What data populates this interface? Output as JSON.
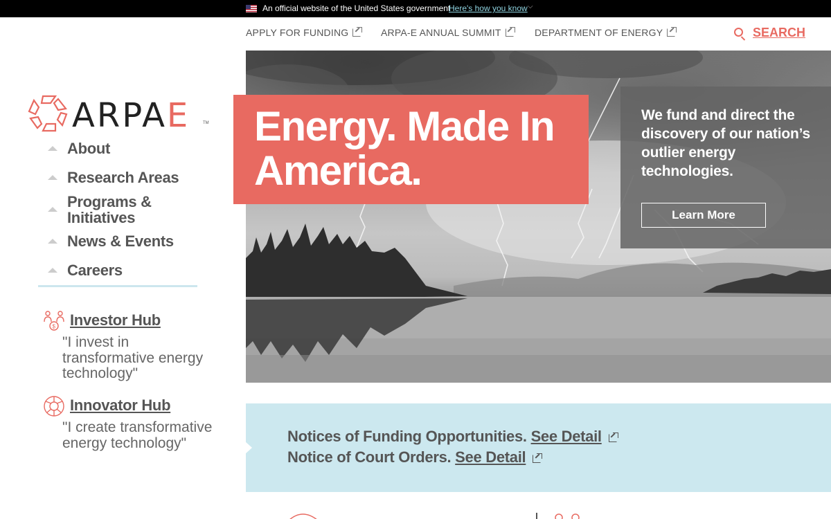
{
  "gov_banner": {
    "text": "An official website of the United States government",
    "link": "Here's how you know"
  },
  "top_nav": {
    "links": [
      {
        "label": "APPLY FOR FUNDING"
      },
      {
        "label": "ARPA-E ANNUAL SUMMIT"
      },
      {
        "label": "DEPARTMENT OF ENERGY"
      }
    ],
    "search_label": "SEARCH"
  },
  "logo": {
    "text_main": "ARPA",
    "text_accent": "E",
    "tm": "TM"
  },
  "side_nav": {
    "items": [
      {
        "label": "About"
      },
      {
        "label": "Research Areas"
      },
      {
        "label": "Programs & Initiatives"
      },
      {
        "label": "News & Events"
      },
      {
        "label": "Careers"
      }
    ]
  },
  "hubs": [
    {
      "title": "Investor Hub",
      "quote": "\"I invest in transformative energy technology\""
    },
    {
      "title": "Innovator Hub",
      "quote": "\"I create transformative energy technology\""
    }
  ],
  "hero": {
    "headline": "Energy. Made In America.",
    "info_text": "We fund and direct the discovery of our nation’s outlier energy technologies.",
    "learn_more": "Learn More"
  },
  "notices": [
    {
      "text": "Notices of Funding Opportunities.",
      "link": "See Detail"
    },
    {
      "text": "Notice of Court Orders.",
      "link": "See Detail"
    }
  ],
  "colors": {
    "accent": "#e86a61",
    "notice_bg": "#cce8ef",
    "text_gray": "#555555"
  }
}
